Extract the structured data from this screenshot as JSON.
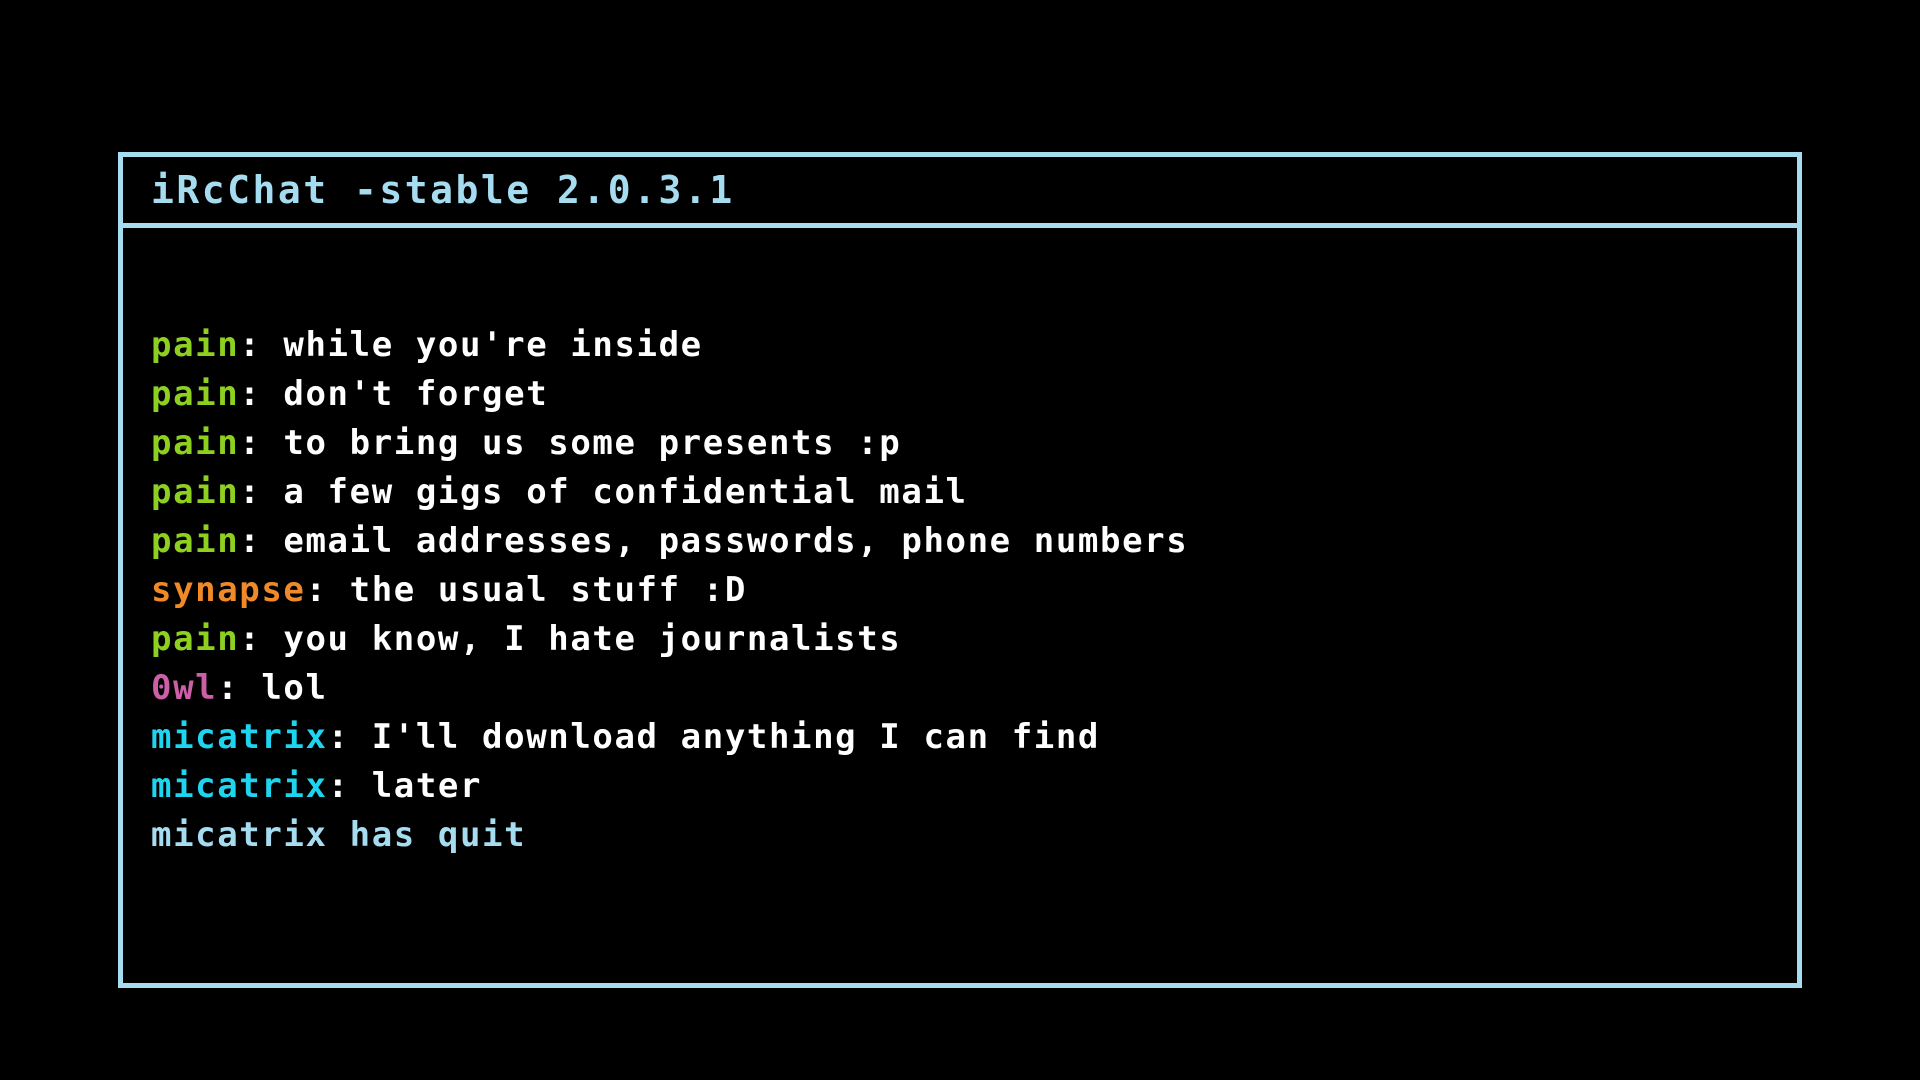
{
  "app": {
    "name": "iRcChat",
    "title": "iRcChat -stable 2.0.3.1",
    "version": "2.0.3.1",
    "channel_mode": "-stable"
  },
  "colors": {
    "background": "#000000",
    "frame": "#a6dcf0",
    "title_text": "#a6dcf0",
    "message_text": "#ffffff",
    "nick_pain": "#8ed020",
    "nick_synapse": "#f08a28",
    "nick_0wl": "#cc5fa8",
    "nick_micatrix": "#1fd4ef",
    "system_text": "#a6dcf0"
  },
  "chat": {
    "separator": ": ",
    "lines": [
      {
        "type": "message",
        "nick": "pain",
        "nick_color": "#8ed020",
        "text": "while you're inside"
      },
      {
        "type": "message",
        "nick": "pain",
        "nick_color": "#8ed020",
        "text": "don't forget"
      },
      {
        "type": "message",
        "nick": "pain",
        "nick_color": "#8ed020",
        "text": "to bring us some presents :p"
      },
      {
        "type": "message",
        "nick": "pain",
        "nick_color": "#8ed020",
        "text": "a few gigs of confidential mail"
      },
      {
        "type": "message",
        "nick": "pain",
        "nick_color": "#8ed020",
        "text": "email addresses, passwords, phone numbers"
      },
      {
        "type": "message",
        "nick": "synapse",
        "nick_color": "#f08a28",
        "text": "the usual stuff :D"
      },
      {
        "type": "message",
        "nick": "pain",
        "nick_color": "#8ed020",
        "text": "you know, I hate journalists"
      },
      {
        "type": "message",
        "nick": "0wl",
        "nick_color": "#cc5fa8",
        "text": "lol"
      },
      {
        "type": "message",
        "nick": "micatrix",
        "nick_color": "#1fd4ef",
        "text": "I'll download anything I can find"
      },
      {
        "type": "message",
        "nick": "micatrix",
        "nick_color": "#1fd4ef",
        "text": "later"
      },
      {
        "type": "system",
        "nick": "",
        "nick_color": "#a6dcf0",
        "text": "micatrix has quit"
      }
    ]
  }
}
